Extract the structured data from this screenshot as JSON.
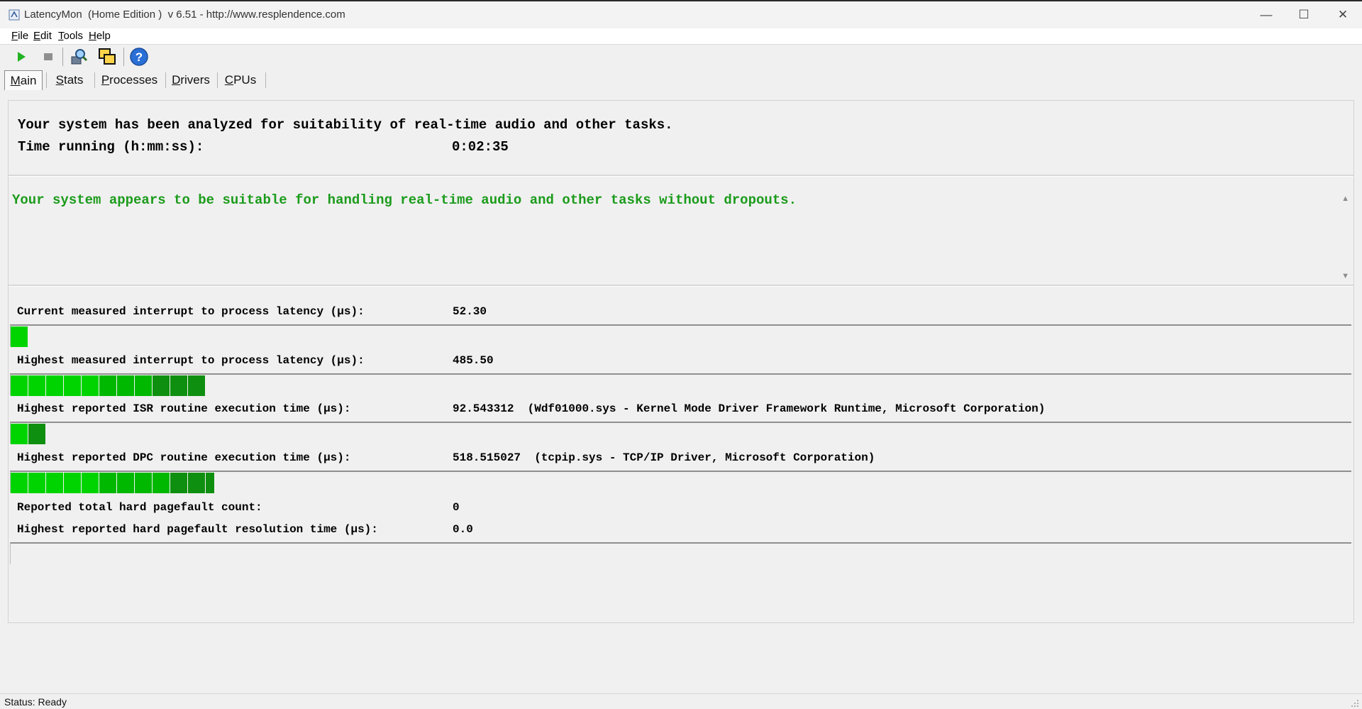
{
  "window": {
    "title": "LatencyMon  (Home Edition )  v 6.51 - http://www.resplendence.com",
    "minimize_glyph": "—",
    "maximize_glyph": "☐",
    "close_glyph": "✕"
  },
  "menu": [
    {
      "accel": "F",
      "rest": "ile"
    },
    {
      "accel": "E",
      "rest": "dit"
    },
    {
      "accel": "T",
      "rest": "ools"
    },
    {
      "accel": "H",
      "rest": "elp"
    }
  ],
  "toolbar": {
    "icons": [
      "play-icon",
      "stop-icon",
      "tools-magnifier-icon",
      "copy-windows-icon",
      "help-icon"
    ]
  },
  "tabs": [
    {
      "accel": "M",
      "rest": "ain",
      "active": true
    },
    {
      "accel": "S",
      "rest": "tats",
      "active": false
    },
    {
      "accel": "P",
      "rest": "rocesses",
      "active": false
    },
    {
      "accel": "D",
      "rest": "rivers",
      "active": false
    },
    {
      "accel": "C",
      "rest": "PUs",
      "active": false
    }
  ],
  "summary": {
    "line1": "Your system has been analyzed for suitability of real-time audio and other tasks.",
    "time_label": "Time running (h:mm:ss):",
    "time_value": "0:02:35"
  },
  "verdict": {
    "text": "Your system appears to be suitable for handling real-time audio and other tasks without dropouts.",
    "color": "#1b9b1b"
  },
  "metrics": [
    {
      "label": "Current measured interrupt to process latency (µs):",
      "value": "52.30",
      "detail": "",
      "bar_segments": 1
    },
    {
      "label": "Highest measured interrupt to process latency (µs):",
      "value": "485.50",
      "detail": "",
      "bar_segments": 11
    },
    {
      "label": "Highest reported ISR routine execution time (µs):",
      "value": "92.543312",
      "detail": "(Wdf01000.sys - Kernel Mode Driver Framework Runtime, Microsoft Corporation)",
      "bar_segments": 2
    },
    {
      "label": "Highest reported DPC routine execution time (µs):",
      "value": "518.515027",
      "detail": "(tcpip.sys - TCP/IP Driver, Microsoft Corporation)",
      "bar_segments": 11.5
    }
  ],
  "pagefault": {
    "count_label": "Reported total hard pagefault count:",
    "count_value": "0",
    "resolution_label": "Highest reported hard pagefault resolution time (µs):",
    "resolution_value": "0.0",
    "bar_segments": 0
  },
  "bar_colors": {
    "bright": "#00d400",
    "mid": "#00b800",
    "dark": "#0f8f0f"
  },
  "status": {
    "text": "Status: Ready"
  }
}
